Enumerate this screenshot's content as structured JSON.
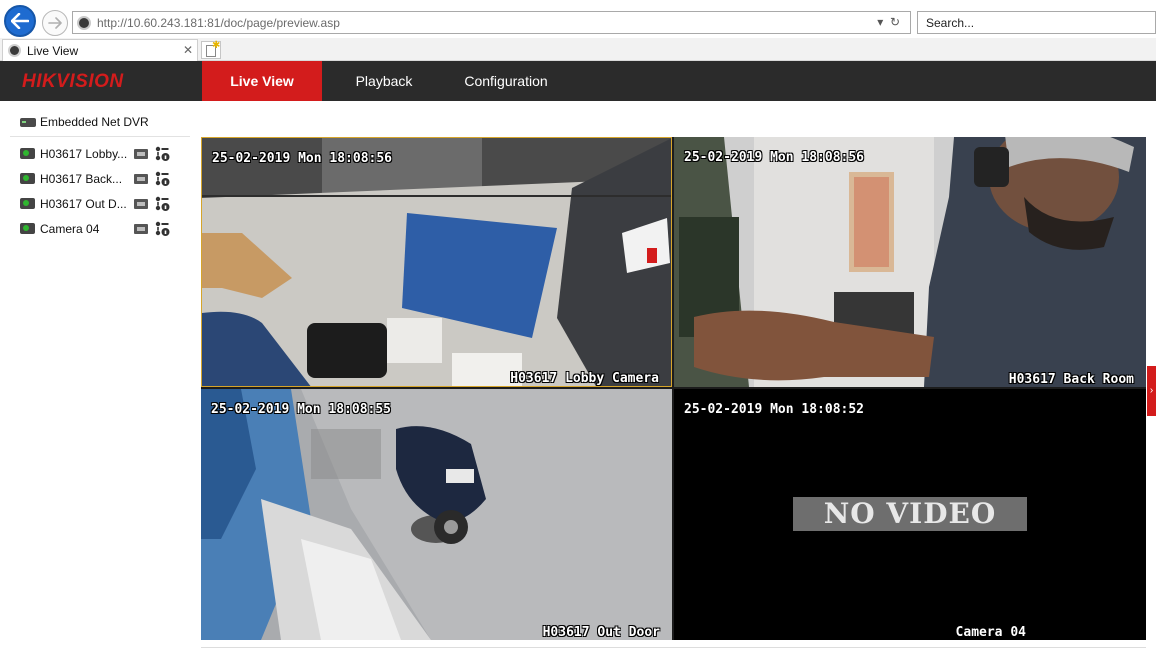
{
  "browser": {
    "url_host": "http://10.60.243.181",
    "url_rest": ":81/doc/page/preview.asp",
    "search_placeholder": "Search...",
    "tab_title": "Live View",
    "icons": {
      "back": "back-arrow-icon",
      "forward": "forward-arrow-icon",
      "refresh": "refresh-icon",
      "dropdown": "chevron-down-icon",
      "close_tab": "close-icon",
      "new_tab": "new-tab-icon"
    }
  },
  "header": {
    "logo": "HIKVISION",
    "menu": [
      {
        "label": "Live View",
        "active": true
      },
      {
        "label": "Playback",
        "active": false
      },
      {
        "label": "Configuration",
        "active": false
      }
    ],
    "accent_color": "#d31c1c",
    "background_color": "#2b2b2b"
  },
  "sidebar": {
    "device": "Embedded Net DVR",
    "cameras": [
      {
        "label": "H03617 Lobby Camera",
        "display": "H03617 Lobby..."
      },
      {
        "label": "H03617 Back Room",
        "display": "H03617 Back..."
      },
      {
        "label": "H03617 Out Door",
        "display": "H03617 Out D..."
      },
      {
        "label": "Camera 04",
        "display": "Camera 04"
      }
    ]
  },
  "video_grid": {
    "tiles": [
      {
        "timestamp": "25-02-2019 Mon 18:08:56",
        "camera_name": "H03617 Lobby Camera",
        "selected": true
      },
      {
        "timestamp": "25-02-2019 Mon 18:08:56",
        "camera_name": "H03617 Back Room",
        "selected": false
      },
      {
        "timestamp": "25-02-2019 Mon 18:08:55",
        "camera_name": "H03617 Out Door",
        "selected": false
      },
      {
        "timestamp": "25-02-2019 Mon 18:08:52",
        "camera_name": "Camera 04",
        "selected": false,
        "no_video": "NO VIDEO"
      }
    ]
  }
}
